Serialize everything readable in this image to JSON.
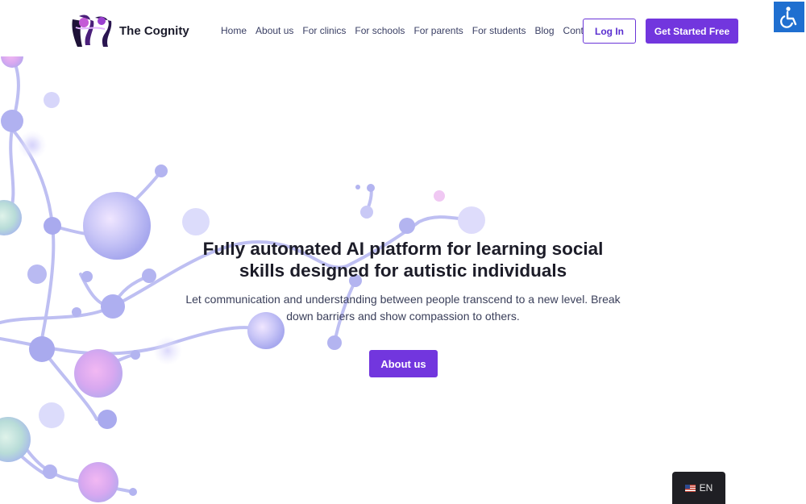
{
  "header": {
    "brand": "The Cognity",
    "nav": [
      "Home",
      "About us",
      "For clinics",
      "For schools",
      "For parents",
      "For students",
      "Blog",
      "Contact"
    ],
    "login_label": "Log In",
    "cta_label": "Get Started Free"
  },
  "hero": {
    "title_line1": "Fully automated AI platform for learning social",
    "title_line2": "skills designed for autistic individuals",
    "subtitle_line1": "Let communication and understanding between people transcend to a new level. Break",
    "subtitle_line2": "down barriers and show compassion to others.",
    "button_label": "About us"
  },
  "language": {
    "code": "EN",
    "flag_icon": "us-flag-icon"
  },
  "accessibility": {
    "icon": "wheelchair-icon"
  },
  "colors": {
    "accent": "#7236de",
    "accessibility": "#1f6fd0",
    "network": "#b3b4f0"
  }
}
